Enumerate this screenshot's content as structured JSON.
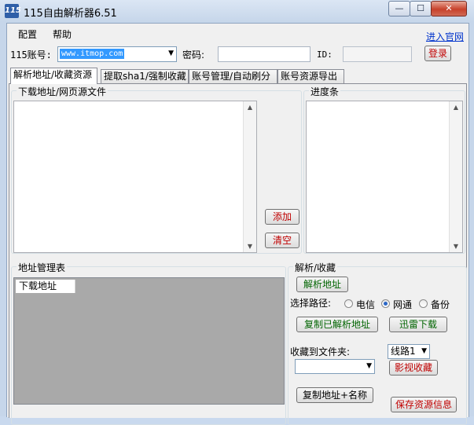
{
  "window": {
    "title": "115自由解析器6.51",
    "icon_text": "115",
    "controls": {
      "minimize": "—",
      "maximize": "☐",
      "close": "✕"
    }
  },
  "menu": {
    "items": [
      "配置",
      "帮助"
    ],
    "link": "进入官网"
  },
  "account": {
    "label": "115账号:",
    "value": "www.itmop.com",
    "password_label": "密码:",
    "password_value": "",
    "id_label": "ID:",
    "id_value": "",
    "login_button": "登录"
  },
  "tabs": [
    "解析地址/收藏资源",
    "提取sha1/强制收藏",
    "账号管理/自动刷分",
    "账号资源导出"
  ],
  "download_group": {
    "title": "下载地址/网页源文件",
    "add_button": "添加",
    "clear_button": "清空"
  },
  "progress_group": {
    "title": "进度条"
  },
  "address_table": {
    "title": "地址管理表",
    "columns": [
      "下载地址"
    ]
  },
  "parse_group": {
    "title": "解析/收藏",
    "parse_button": "解析地址",
    "path_label": "选择路径:",
    "paths": [
      "电信",
      "网通",
      "备份"
    ],
    "selected_path": "网通",
    "copy_parsed_button": "复制已解析地址",
    "thunder_button": "迅雷下载",
    "folder_label": "收藏到文件夹:",
    "folder_value": "",
    "route_value": "线路1",
    "video_button": "影视收藏",
    "copy_name_button": "复制地址+名称",
    "save_info_button": "保存资源信息"
  },
  "icons": [
    "scroll-up-icon",
    "scroll-down-icon",
    "dropdown-arrow-icon",
    "radio-icon"
  ],
  "colors": {
    "title_bar": "#c6d6ea",
    "accent_green": "#006400",
    "accent_red": "#c00000",
    "link": "#0033cc"
  }
}
